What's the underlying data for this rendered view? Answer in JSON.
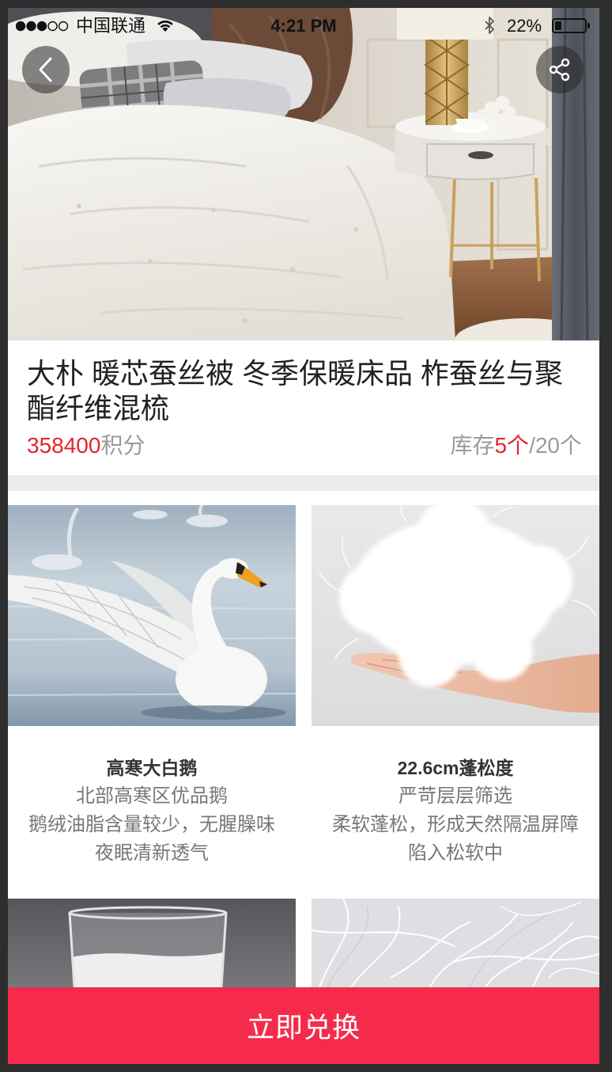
{
  "status_bar": {
    "signal_strength": 3,
    "signal_max": 5,
    "carrier": "中国联通",
    "time": "4:21 PM",
    "battery_text": "22%",
    "battery_level": 0.22
  },
  "product": {
    "title": "大朴 暖芯蚕丝被 冬季保暖床品 柞蚕丝与聚酯纤维混梳",
    "points": "358400",
    "points_unit": "积分",
    "stock_label": "库存",
    "stock_remaining": "5个",
    "stock_total": "/20个"
  },
  "features": [
    {
      "title": "高寒大白鹅",
      "lines": [
        "北部高寒区优品鹅",
        "鹅绒油脂含量较少，无腥臊味",
        "夜眠清新透气"
      ]
    },
    {
      "title": "22.6cm蓬松度",
      "lines": [
        "严苛层层筛选",
        "柔软蓬松，形成天然隔温屏障",
        "陷入松软中"
      ]
    }
  ],
  "actions": {
    "exchange_label": "立即兑换"
  },
  "icons": {
    "back": "chevron-left-icon",
    "share": "share-icon",
    "signal": "signal-dots-icon",
    "wifi": "wifi-icon",
    "bluetooth": "bluetooth-icon",
    "battery": "battery-icon"
  },
  "colors": {
    "accent": "#f62b4b",
    "price": "#e5232b",
    "title": "#222222",
    "muted": "#9a9a9a",
    "body_text": "#777777",
    "separator": "#ececec",
    "frame": "#2e2e2e"
  }
}
